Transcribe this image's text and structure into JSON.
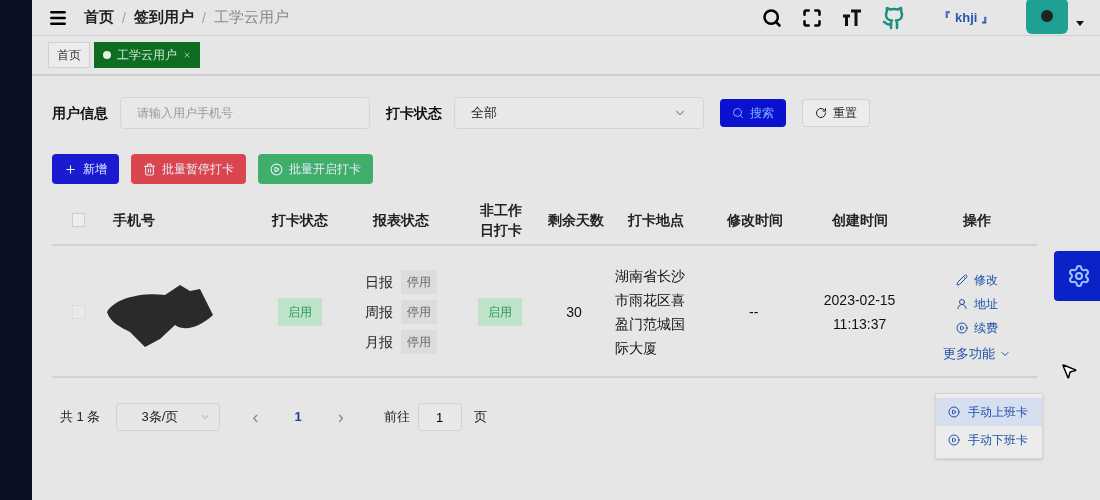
{
  "breadcrumb": [
    "首页",
    "签到用户",
    "工学云用户"
  ],
  "breadcrumb_separators": [
    "/",
    "/"
  ],
  "header": {
    "user": "『 khji 』"
  },
  "tabs": [
    {
      "label": "首页",
      "selected": false
    },
    {
      "label": "工学云用户",
      "selected": true
    }
  ],
  "filters": {
    "user_label": "用户信息",
    "user_placeholder": "请输入用户手机号",
    "status_label": "打卡状态",
    "status_value": "全部",
    "search": "搜索",
    "reset": "重置"
  },
  "actions": [
    {
      "kind": "add",
      "label": "新增"
    },
    {
      "kind": "pause",
      "label": "批量暂停打卡"
    },
    {
      "kind": "start",
      "label": "批量开启打卡"
    }
  ],
  "table": {
    "all_checked": false,
    "columns": [
      "手机号",
      "打卡状态",
      "报表状态",
      "非工作日打卡",
      "剩余天数",
      "打卡地点",
      "修改时间",
      "创建时间",
      "操作"
    ],
    "rows": [
      {
        "checked": false,
        "punch_status": "启用",
        "reports": [
          {
            "label": "日报",
            "status": "停用"
          },
          {
            "label": "周报",
            "status": "停用"
          },
          {
            "label": "月报",
            "status": "停用"
          }
        ],
        "holiday_punch": "启用",
        "days_left": "30",
        "location": "湖南省长沙市雨花区喜盈门范城国际大厦",
        "modified": "--",
        "created": [
          "2023-02-15",
          "11:13:37"
        ],
        "ops": [
          {
            "kind": "edit",
            "label": "修改"
          },
          {
            "kind": "address",
            "label": "地址"
          },
          {
            "kind": "renew",
            "label": "续费"
          },
          {
            "kind": "more",
            "label": "更多功能"
          }
        ]
      }
    ]
  },
  "menu": [
    {
      "label": "手动上班卡",
      "selected": true
    },
    {
      "label": "手动下班卡",
      "selected": false
    }
  ],
  "pagination": {
    "total": "共 1 条",
    "page_size": "3条/页",
    "prev": "‹",
    "page": "1",
    "next": "›",
    "goto_label": "前往",
    "goto_value": "1",
    "goto_unit": "页"
  }
}
